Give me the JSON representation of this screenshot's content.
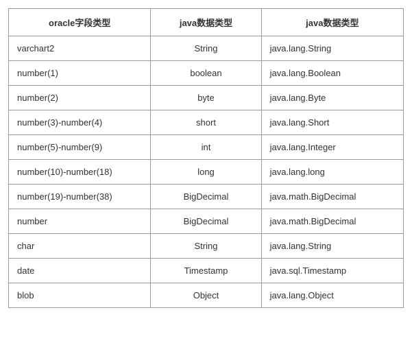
{
  "table": {
    "headers": [
      "oracle字段类型",
      "java数据类型",
      "java数据类型"
    ],
    "rows": [
      {
        "c1": "varchart2",
        "c2": "String",
        "c3": "java.lang.String"
      },
      {
        "c1": "number(1)",
        "c2": "boolean",
        "c3": "java.lang.Boolean"
      },
      {
        "c1": "number(2)",
        "c2": "byte",
        "c3": "java.lang.Byte"
      },
      {
        "c1": "number(3)-number(4)",
        "c2": "short",
        "c3": "java.lang.Short"
      },
      {
        "c1": "number(5)-number(9)",
        "c2": "int",
        "c3": "java.lang.Integer"
      },
      {
        "c1": "number(10)-number(18)",
        "c2": "long",
        "c3": "java.lang.long"
      },
      {
        "c1": "number(19)-number(38)",
        "c2": "BigDecimal",
        "c3": "java.math.BigDecimal"
      },
      {
        "c1": "number",
        "c2": "BigDecimal",
        "c3": "java.math.BigDecimal"
      },
      {
        "c1": "char",
        "c2": "String",
        "c3": "java.lang.String"
      },
      {
        "c1": "date",
        "c2": "Timestamp",
        "c3": "java.sql.Timestamp"
      },
      {
        "c1": "blob",
        "c2": "Object",
        "c3": "java.lang.Object"
      }
    ]
  }
}
